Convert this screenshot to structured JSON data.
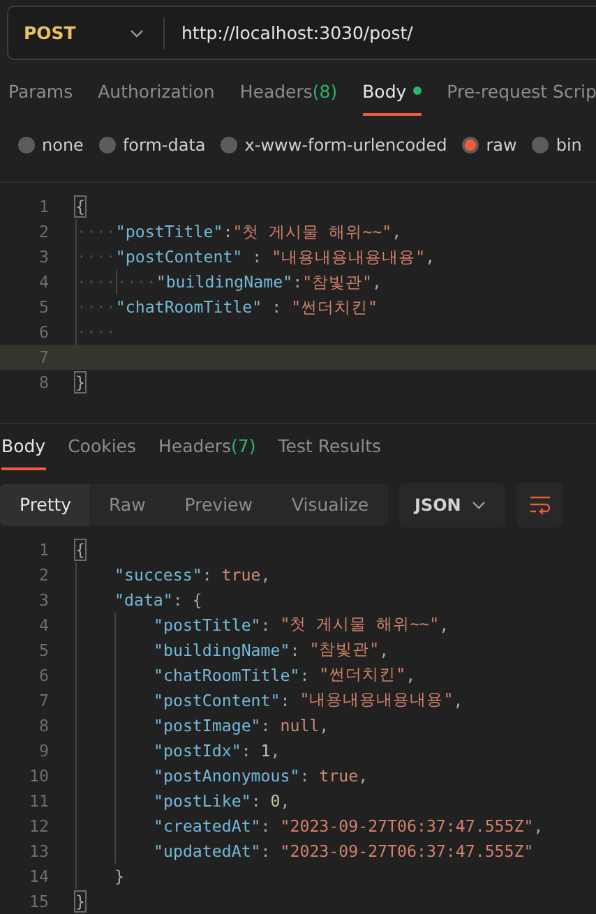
{
  "request": {
    "method": "POST",
    "url": "http://localhost:3030/post/"
  },
  "request_tabs": [
    {
      "label": "Params",
      "selected": false
    },
    {
      "label": "Authorization",
      "selected": false
    },
    {
      "label": "Headers",
      "count": "(8)",
      "selected": false
    },
    {
      "label": "Body",
      "dot": true,
      "selected": true
    },
    {
      "label": "Pre-request Scrip",
      "selected": false
    }
  ],
  "body_types": [
    {
      "label": "none",
      "selected": false
    },
    {
      "label": "form-data",
      "selected": false
    },
    {
      "label": "x-www-form-urlencoded",
      "selected": false
    },
    {
      "label": "raw",
      "selected": true
    },
    {
      "label": "bin",
      "selected": false
    }
  ],
  "request_editor": [
    {
      "number": "1",
      "current": false,
      "tokens": [
        {
          "kind": "bracket",
          "text": "{"
        }
      ]
    },
    {
      "number": "2",
      "current": false,
      "tokens": [
        {
          "kind": "indent",
          "text": "····"
        },
        {
          "kind": "key",
          "text": "\"postTitle\""
        },
        {
          "kind": "punct",
          "text": ":"
        },
        {
          "kind": "string",
          "text": "\"첫 게시물 해위~~\""
        },
        {
          "kind": "punct",
          "text": ","
        }
      ]
    },
    {
      "number": "3",
      "current": false,
      "tokens": [
        {
          "kind": "indent",
          "text": "····"
        },
        {
          "kind": "key",
          "text": "\"postContent\""
        },
        {
          "kind": "punct",
          "text": " : "
        },
        {
          "kind": "string",
          "text": "\"내용내용내용내용\""
        },
        {
          "kind": "punct",
          "text": ","
        }
      ]
    },
    {
      "number": "4",
      "current": false,
      "tokens": [
        {
          "kind": "indent",
          "text": "····"
        },
        {
          "kind": "indent",
          "text": "····"
        },
        {
          "kind": "key",
          "text": "\"buildingName\""
        },
        {
          "kind": "punct",
          "text": ":"
        },
        {
          "kind": "string",
          "text": "\"참빛관\""
        },
        {
          "kind": "punct",
          "text": ","
        }
      ]
    },
    {
      "number": "5",
      "current": false,
      "tokens": [
        {
          "kind": "indent",
          "text": "····"
        },
        {
          "kind": "key",
          "text": "\"chatRoomTitle\""
        },
        {
          "kind": "punct",
          "text": " : "
        },
        {
          "kind": "string",
          "text": "\"썬더치킨\""
        }
      ]
    },
    {
      "number": "6",
      "current": false,
      "tokens": [
        {
          "kind": "indent",
          "text": "····"
        }
      ]
    },
    {
      "number": "7",
      "current": true
    },
    {
      "number": "8",
      "current": false,
      "tokens": [
        {
          "kind": "bracket",
          "text": "}"
        }
      ]
    }
  ],
  "response_tabs": [
    {
      "label": "Body",
      "selected": true
    },
    {
      "label": "Cookies",
      "selected": false
    },
    {
      "label": "Headers",
      "count": "(7)",
      "selected": false
    },
    {
      "label": "Test Results",
      "selected": false
    }
  ],
  "view_modes": [
    {
      "label": "Pretty",
      "selected": true
    },
    {
      "label": "Raw",
      "selected": false
    },
    {
      "label": "Preview",
      "selected": false
    },
    {
      "label": "Visualize",
      "selected": false
    }
  ],
  "format": "JSON",
  "response_body": [
    {
      "number": "1",
      "kind": "root",
      "tokens": [
        {
          "kind": "bracket",
          "text": "{"
        }
      ]
    },
    {
      "number": "2",
      "kind": "member",
      "tokens": [
        {
          "kind": "key",
          "text": "\"success\""
        },
        {
          "kind": "punct",
          "text": ": "
        },
        {
          "kind": "literal",
          "text": "true"
        },
        {
          "kind": "punct",
          "text": ","
        }
      ]
    },
    {
      "number": "3",
      "kind": "member",
      "tokens": [
        {
          "kind": "key",
          "text": "\"data\""
        },
        {
          "kind": "punct",
          "text": ": {"
        }
      ]
    },
    {
      "number": "4",
      "kind": "nested",
      "tokens": [
        {
          "kind": "key",
          "text": "\"postTitle\""
        },
        {
          "kind": "punct",
          "text": ": "
        },
        {
          "kind": "string",
          "text": "\"첫 게시물 해위~~\""
        },
        {
          "kind": "punct",
          "text": ","
        }
      ]
    },
    {
      "number": "5",
      "kind": "nested",
      "tokens": [
        {
          "kind": "key",
          "text": "\"buildingName\""
        },
        {
          "kind": "punct",
          "text": ": "
        },
        {
          "kind": "string",
          "text": "\"참빛관\""
        },
        {
          "kind": "punct",
          "text": ","
        }
      ]
    },
    {
      "number": "6",
      "kind": "nested",
      "tokens": [
        {
          "kind": "key",
          "text": "\"chatRoomTitle\""
        },
        {
          "kind": "punct",
          "text": ": "
        },
        {
          "kind": "string",
          "text": "\"썬더치킨\""
        },
        {
          "kind": "punct",
          "text": ","
        }
      ]
    },
    {
      "number": "7",
      "kind": "nested",
      "tokens": [
        {
          "kind": "key",
          "text": "\"postContent\""
        },
        {
          "kind": "punct",
          "text": ": "
        },
        {
          "kind": "string",
          "text": "\"내용내용내용내용\""
        },
        {
          "kind": "punct",
          "text": ","
        }
      ]
    },
    {
      "number": "8",
      "kind": "nested",
      "tokens": [
        {
          "kind": "key",
          "text": "\"postImage\""
        },
        {
          "kind": "punct",
          "text": ": "
        },
        {
          "kind": "literal",
          "text": "null"
        },
        {
          "kind": "punct",
          "text": ","
        }
      ]
    },
    {
      "number": "9",
      "kind": "nested",
      "tokens": [
        {
          "kind": "key",
          "text": "\"postIdx\""
        },
        {
          "kind": "punct",
          "text": ": "
        },
        {
          "kind": "number",
          "text": "1"
        },
        {
          "kind": "punct",
          "text": ","
        }
      ]
    },
    {
      "number": "10",
      "kind": "nested",
      "tokens": [
        {
          "kind": "key",
          "text": "\"postAnonymous\""
        },
        {
          "kind": "punct",
          "text": ": "
        },
        {
          "kind": "literal",
          "text": "true"
        },
        {
          "kind": "punct",
          "text": ","
        }
      ]
    },
    {
      "number": "11",
      "kind": "nested",
      "tokens": [
        {
          "kind": "key",
          "text": "\"postLike\""
        },
        {
          "kind": "punct",
          "text": ": "
        },
        {
          "kind": "number",
          "text": "0"
        },
        {
          "kind": "punct",
          "text": ","
        }
      ]
    },
    {
      "number": "12",
      "kind": "nested",
      "tokens": [
        {
          "kind": "key",
          "text": "\"createdAt\""
        },
        {
          "kind": "punct",
          "text": ": "
        },
        {
          "kind": "string",
          "text": "\"2023-09-27T06:37:47.555Z\""
        },
        {
          "kind": "punct",
          "text": ","
        }
      ]
    },
    {
      "number": "13",
      "kind": "nested",
      "tokens": [
        {
          "kind": "key",
          "text": "\"updatedAt\""
        },
        {
          "kind": "punct",
          "text": ": "
        },
        {
          "kind": "string",
          "text": "\"2023-09-27T06:37:47.555Z\""
        }
      ]
    },
    {
      "number": "14",
      "kind": "member",
      "tokens": [
        {
          "kind": "punct",
          "text": "}"
        }
      ]
    },
    {
      "number": "15",
      "kind": "root",
      "tokens": [
        {
          "kind": "bracket",
          "text": "}"
        }
      ]
    }
  ]
}
